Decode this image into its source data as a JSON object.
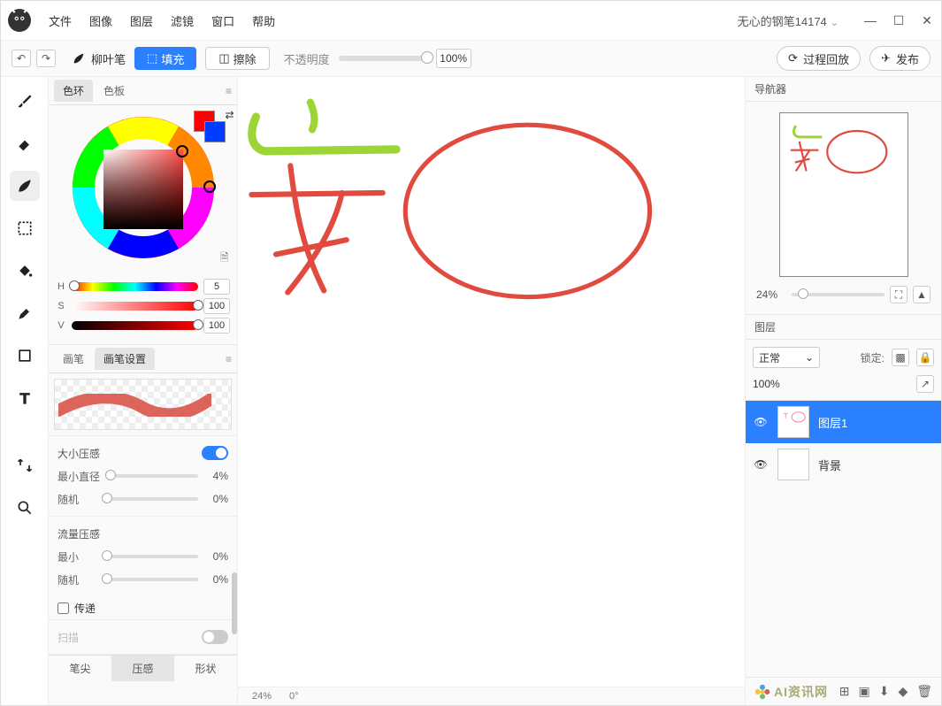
{
  "menu": {
    "items": [
      "文件",
      "图像",
      "图层",
      "滤镜",
      "窗口",
      "帮助"
    ]
  },
  "user": "无心的钢笔14174",
  "toolbar": {
    "brush_name": "柳叶笔",
    "fill": "填充",
    "erase": "擦除",
    "opacity_label": "不透明度",
    "opacity_value": "100%",
    "playback": "过程回放",
    "publish": "发布"
  },
  "color_panel": {
    "tabs": [
      "色环",
      "色板"
    ],
    "active_tab": 0,
    "H": 5,
    "S": 100,
    "V": 100,
    "fg": "#ff0000",
    "bg": "#003cff"
  },
  "brush_panel": {
    "tabs": [
      "画笔",
      "画笔设置"
    ],
    "active_tab": 1,
    "bottom_tabs": [
      "笔尖",
      "压感",
      "形状"
    ],
    "bottom_active": 1,
    "size_pressure": "大小压感",
    "min_diam_label": "最小直径",
    "min_diam": "4%",
    "random_label": "随机",
    "random_size": "0%",
    "flow_pressure": "流量压感",
    "min_label": "最小",
    "min_flow": "0%",
    "random_flow": "0%",
    "pass_label": "传递",
    "expand_label": "扫描",
    "size_pressure_on": true,
    "flow_pressure_on": true,
    "pass_on": false
  },
  "right": {
    "navigator_label": "导航器",
    "layers_label": "图层",
    "nav_zoom": "24%",
    "mode": "正常",
    "lock_label": "锁定:",
    "layer_opacity": "100%",
    "layers": [
      {
        "name": "图层1",
        "active": true
      },
      {
        "name": "背景",
        "active": false
      }
    ]
  },
  "status": {
    "zoom": "24%",
    "angle": "0°"
  },
  "watermark": "AI资讯网"
}
